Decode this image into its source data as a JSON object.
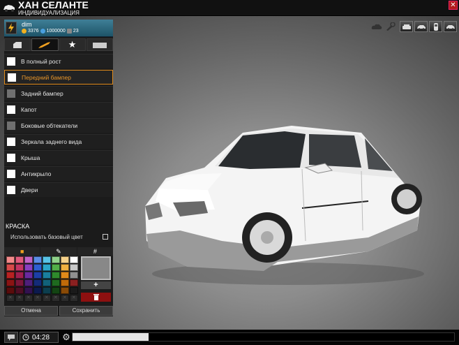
{
  "header": {
    "title": "ХАН СЕЛАНТЕ",
    "subtitle": "ИНДИВИДУАЛИЗАЦИЯ",
    "close_icon": "close-icon"
  },
  "camera_tools": [
    "cloud-icon",
    "wrench-icon"
  ],
  "view_buttons": [
    "car-front-icon",
    "car-side-icon",
    "car-top-icon",
    "car-rear-icon"
  ],
  "profile": {
    "name": "dim",
    "money": "3376",
    "points": "1000000",
    "level": "23"
  },
  "tabs": [
    "door-icon",
    "paint-brush-icon",
    "star-icon",
    "license-plate-icon"
  ],
  "parts": [
    {
      "label": "В полный рост",
      "checked": true
    },
    {
      "label": "Передний бампер",
      "selected": true
    },
    {
      "label": "Задний бампер"
    },
    {
      "label": "Капот",
      "checked": true
    },
    {
      "label": "Боковые обтекатели"
    },
    {
      "label": "Зеркала заднего вида",
      "checked": true
    },
    {
      "label": "Крыша",
      "checked": true
    },
    {
      "label": "Антикрыло",
      "checked": true
    },
    {
      "label": "Двери",
      "checked": true
    }
  ],
  "paint": {
    "title": "КРАСКА",
    "base_color_label": "Использовать базовый цвет",
    "palette_tabs": [
      "palette-icon",
      "pipette-icon",
      "#"
    ],
    "swatches": [
      "#f28a8a",
      "#e05b7c",
      "#c163c4",
      "#5b8de6",
      "#58c3e6",
      "#8fd28a",
      "#f5d18a",
      "#ffffff",
      "#d74a4a",
      "#c33463",
      "#8a3fbf",
      "#2e5fd1",
      "#2aa6c9",
      "#52b048",
      "#f0b040",
      "#c8c8c8",
      "#b82222",
      "#9e1f4f",
      "#6a2a9e",
      "#1c3fa6",
      "#1a7f9e",
      "#2f8a2c",
      "#e08a1a",
      "#909090",
      "#8a1414",
      "#7a163a",
      "#4e1f7a",
      "#142b78",
      "#12627a",
      "#1f6a1f",
      "#c06a0a",
      "#8a2020",
      "#5a0c0c",
      "#4e0e24",
      "#321250",
      "#0c1a4e",
      "#0c3e4e",
      "#134413",
      "#8a4a06",
      "#1a1a1a"
    ],
    "empty_rows": 1,
    "preview_color": "#888888",
    "add_label": "+",
    "delete_icon": "trash-icon",
    "cancel_label": "Отмена",
    "save_label": "Сохранить"
  },
  "footer": {
    "chat_icon": "chat-icon",
    "time": "04:28",
    "settings_icon": "gear-icon",
    "progress": 0.2
  }
}
